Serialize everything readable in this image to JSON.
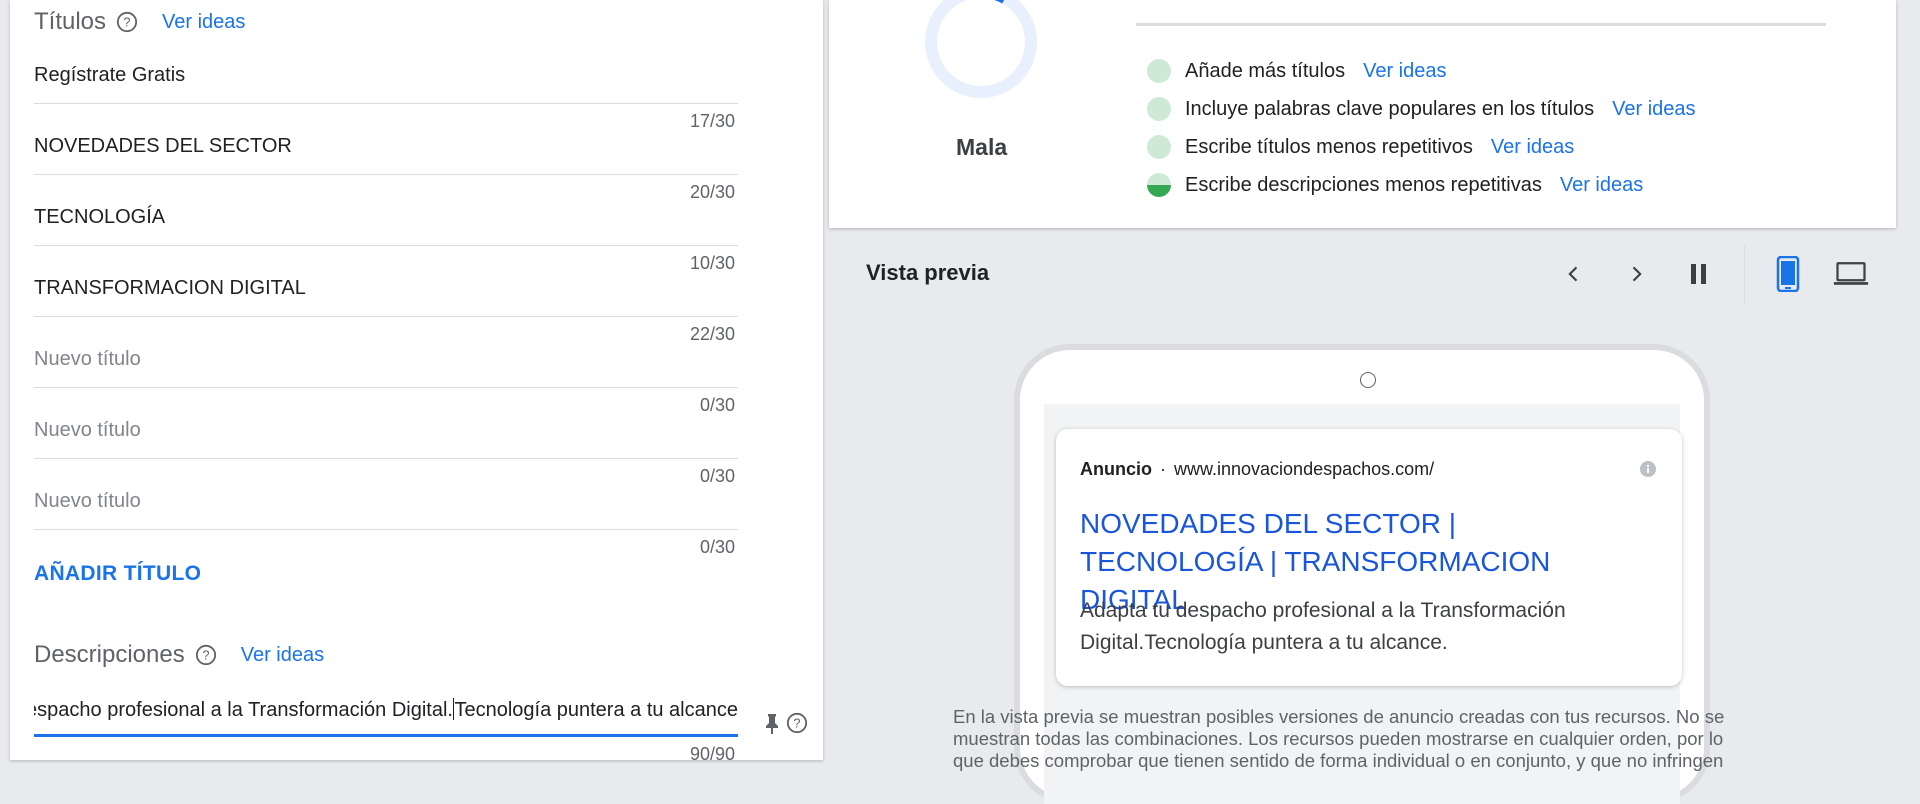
{
  "titles_section": {
    "label": "Títulos",
    "ideas_link": "Ver ideas",
    "fields": [
      {
        "value": "Regístrate Gratis",
        "placeholder": "",
        "counter": "17/30"
      },
      {
        "value": "NOVEDADES DEL SECTOR",
        "placeholder": "",
        "counter": "20/30"
      },
      {
        "value": "TECNOLOGÍA",
        "placeholder": "",
        "counter": "10/30"
      },
      {
        "value": "TRANSFORMACION DIGITAL",
        "placeholder": "",
        "counter": "22/30"
      },
      {
        "value": "",
        "placeholder": "Nuevo título",
        "counter": "0/30"
      },
      {
        "value": "",
        "placeholder": "Nuevo título",
        "counter": "0/30"
      },
      {
        "value": "",
        "placeholder": "Nuevo título",
        "counter": "0/30"
      }
    ],
    "add_button": "AÑADIR TÍTULO"
  },
  "descriptions_section": {
    "label": "Descripciones",
    "ideas_link": "Ver ideas",
    "field": {
      "value_before_caret": "Adapta tu despacho profesional a la Transformación Digital.",
      "value_after_caret": "Tecnología puntera a tu alcance",
      "counter": "90/90"
    }
  },
  "ad_strength": {
    "rating": "Mala",
    "progress_fraction": 0.08,
    "tips": [
      {
        "text": "Añade más títulos",
        "link": "Ver ideas",
        "status": "pending"
      },
      {
        "text": "Incluye palabras clave populares en los títulos",
        "link": "Ver ideas",
        "status": "pending"
      },
      {
        "text": "Escribe títulos menos repetitivos",
        "link": "Ver ideas",
        "status": "pending"
      },
      {
        "text": "Escribe descripciones menos repetitivas",
        "link": "Ver ideas",
        "status": "partial"
      }
    ]
  },
  "preview": {
    "title": "Vista previa",
    "ad": {
      "label": "Anuncio",
      "separator": "·",
      "url": "www.innovaciondespachos.com/",
      "headline": "NOVEDADES DEL SECTOR | TECNOLOGÍA | TRANSFORMACION DIGITAL",
      "description": "Adapta tu despacho profesional a la Transformación Digital.Tecnología puntera a tu alcance."
    },
    "disclaimer": "En la vista previa se muestran posibles versiones de anuncio creadas con tus recursos. No se muestran todas las combinaciones. Los recursos pueden mostrarse en cualquier orden, por lo que debes comprobar que tienen sentido de forma individual o en conjunto, y que no infringen"
  },
  "colors": {
    "accent": "#1a73e8",
    "ad_headline": "#1a56db",
    "tip_pending": "#ceead6",
    "tip_done": "#34a853"
  }
}
